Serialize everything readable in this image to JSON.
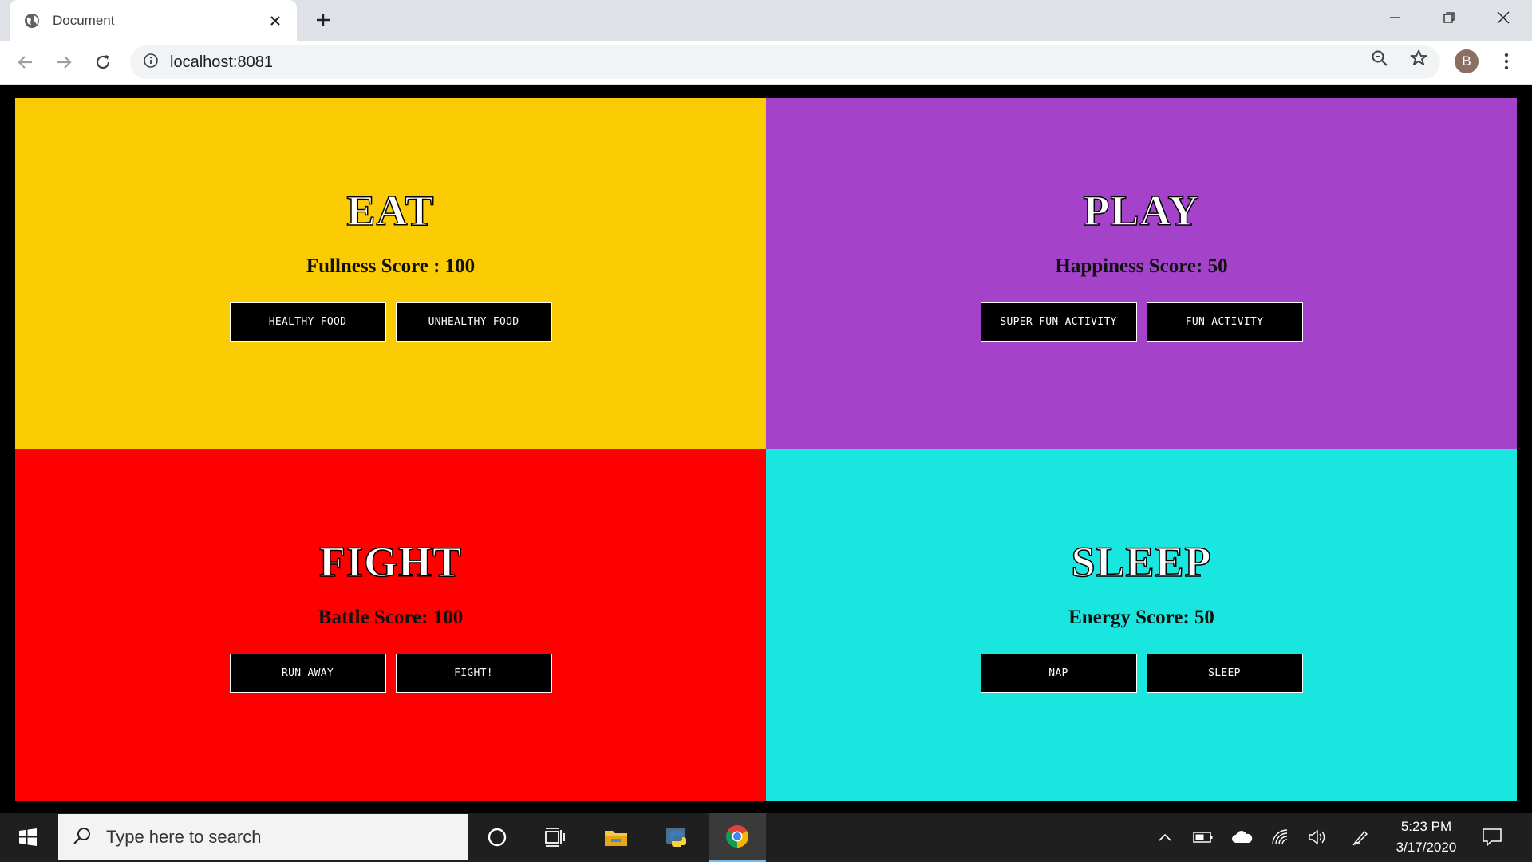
{
  "browser": {
    "tab_title": "Document",
    "url": "localhost:8081",
    "profile_initial": "B"
  },
  "panels": [
    {
      "heading": "EAT",
      "score": "Fullness Score : 100",
      "buttons": [
        "HEALTHY FOOD",
        "UNHEALTHY FOOD"
      ],
      "color": "#fbcc04"
    },
    {
      "heading": "PLAY",
      "score": "Happiness Score: 50",
      "buttons": [
        "SUPER FUN ACTIVITY",
        "FUN ACTIVITY"
      ],
      "color": "#a443c9"
    },
    {
      "heading": "FIGHT",
      "score": "Battle Score: 100",
      "buttons": [
        "RUN AWAY",
        "FIGHT!"
      ],
      "color": "#ff0000"
    },
    {
      "heading": "SLEEP",
      "score": "Energy Score: 50",
      "buttons": [
        "NAP",
        "SLEEP"
      ],
      "color": "#1ae6e0"
    }
  ],
  "taskbar": {
    "search_placeholder": "Type here to search",
    "time": "5:23 PM",
    "date": "3/17/2020"
  },
  "icons": [
    "windows-start-icon",
    "search-icon",
    "cortana-icon",
    "task-view-icon",
    "file-explorer-icon",
    "python-icon",
    "chrome-icon",
    "chevron-up-icon",
    "battery-icon",
    "onedrive-icon",
    "wifi-icon",
    "volume-icon",
    "pen-icon",
    "notifications-icon"
  ]
}
